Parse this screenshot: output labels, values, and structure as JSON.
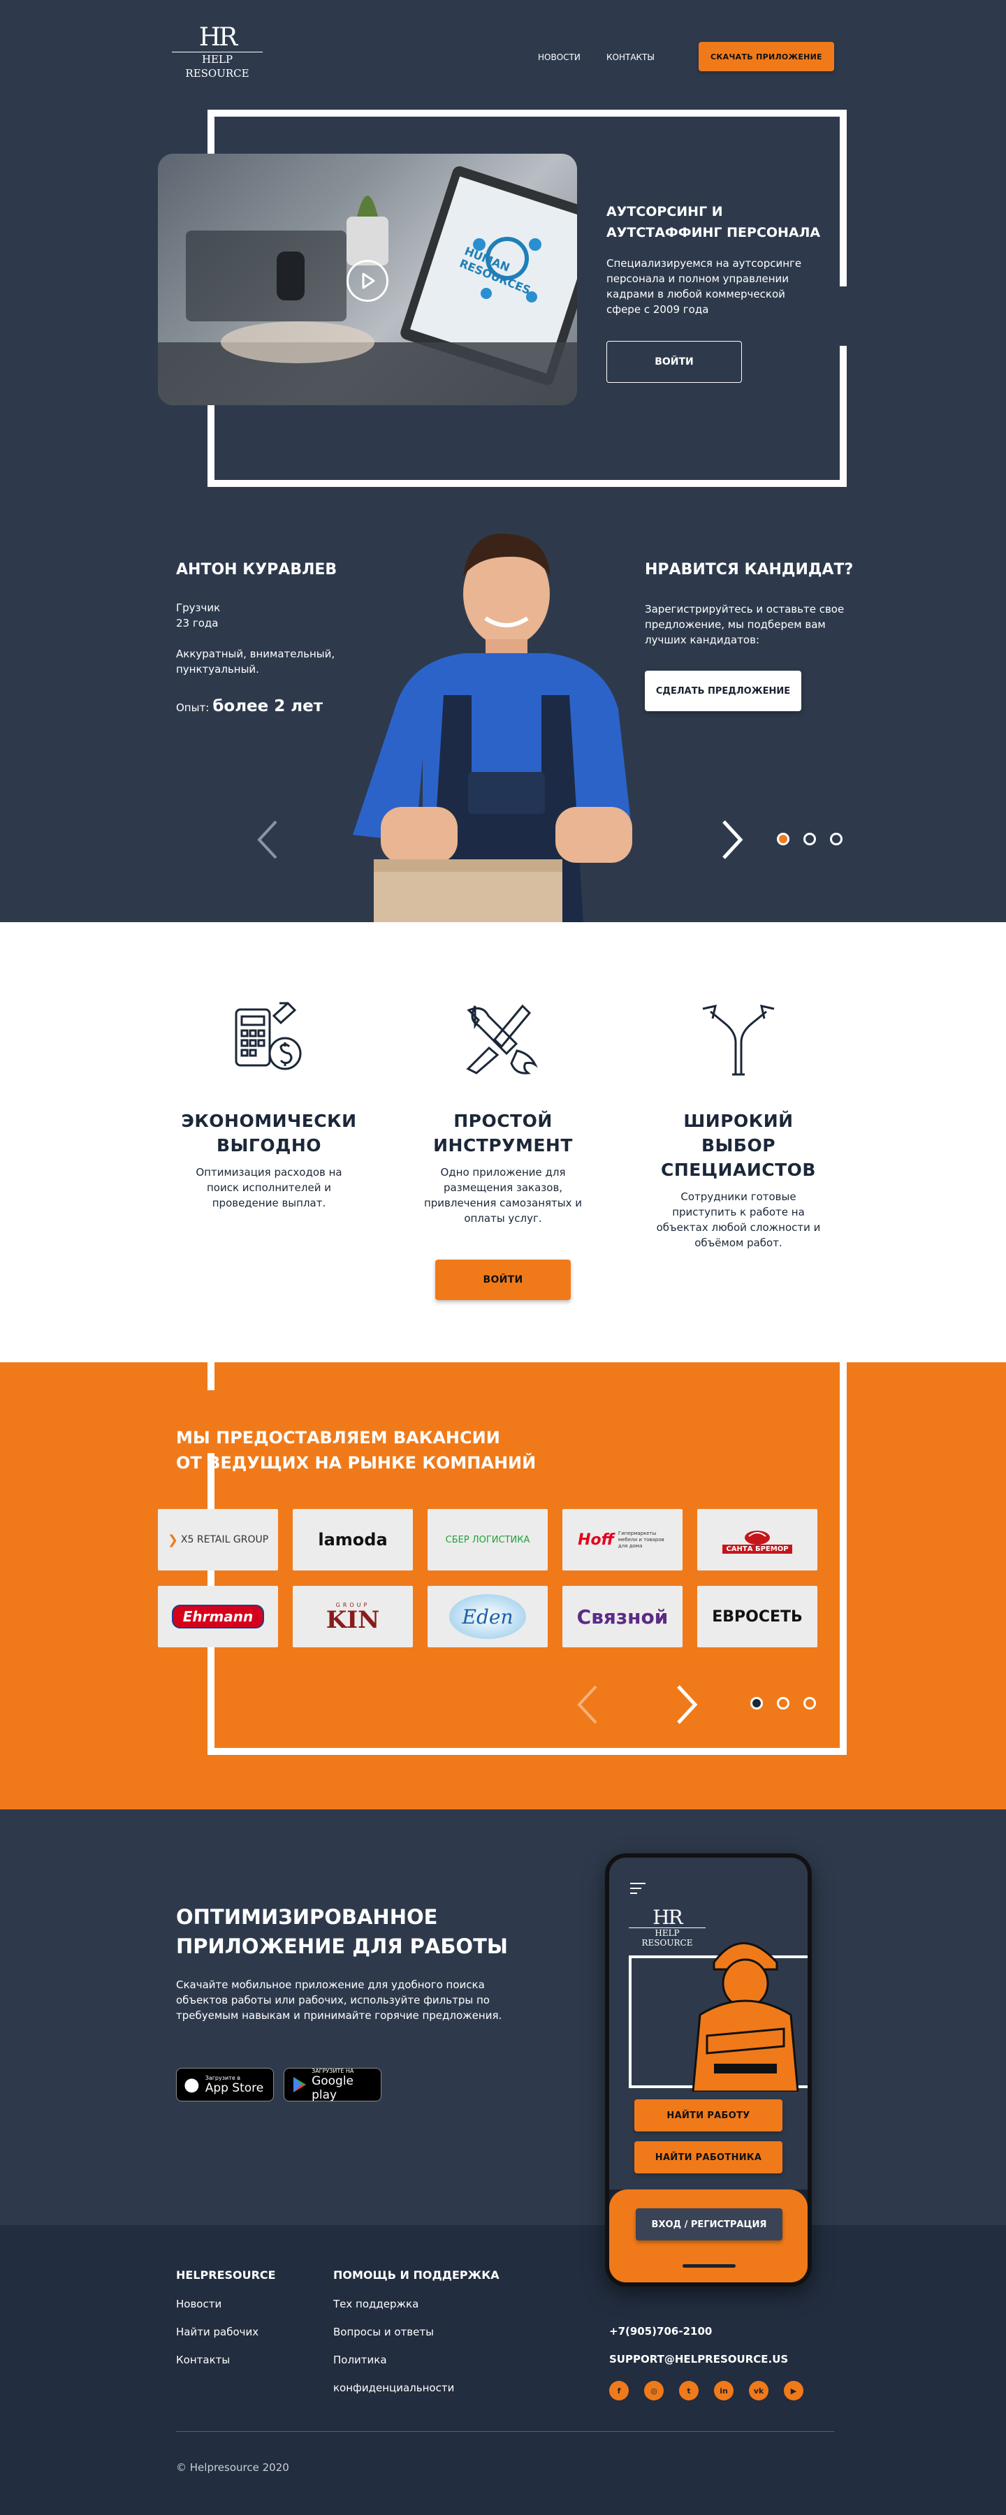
{
  "colors": {
    "bg_dark": "#2e3a4c",
    "accent": "#f07a1a",
    "footer": "#222d3f",
    "white": "#ffffff"
  },
  "header": {
    "logo_mark": "HR",
    "logo_text": "HELP RESOURCE",
    "nav": [
      "НОВОСТИ",
      "КОНТАКТЫ"
    ],
    "cta": "СКАЧАТЬ ПРИЛОЖЕНИЕ"
  },
  "hero": {
    "title_line1": "АУТСОРСИНГ И",
    "title_line2": "АУТСТАФФИНГ ПЕРСОНАЛА",
    "text": "Специализируемся на аутсорсинге персонала и полном управлении кадрами в любой коммерческой сфере с 2009 года",
    "button": "ВОЙТИ",
    "video_caption": "HUMAN RESOURCES",
    "play_icon": "play-icon"
  },
  "candidate": {
    "name": "АНТОН КУРАВЛЕВ",
    "role": "Грузчик",
    "age": "23 года",
    "traits": "Аккуратный, внимательный, пунктуальный.",
    "exp_label": "Опыт:",
    "exp_value": "более 2 лет",
    "offer_title": "НРАВИТСЯ КАНДИДАТ?",
    "offer_text": "Зарегистрируйтесь и оставьте свое предложение, мы подберем вам лучших кандидатов:",
    "offer_button": "СДЕЛАТЬ ПРЕДЛОЖЕНИЕ"
  },
  "features": {
    "items": [
      {
        "title_line1": "ЭКОНОМИЧЕСКИ",
        "title_line2": "ВЫГОДНО",
        "text": "Оптимизация расходов на поиск исполнителей и проведение выплат.",
        "icon": "calculator-money-icon"
      },
      {
        "title_line1": "ПРОСТОЙ",
        "title_line2": "ИНСТРУМЕНТ",
        "text": "Одно приложение для размещения заказов, привлечения самозанятых и оплаты услуг.",
        "icon": "tools-icon"
      },
      {
        "title_line1": "ШИРОКИЙ ВЫБОР",
        "title_line2": "СПЕЦИАИСТОВ",
        "text": "Сотрудники готовые приступить к работе на объектах любой сложности и объёмом работ.",
        "icon": "split-arrows-icon"
      }
    ],
    "button": "ВОЙТИ"
  },
  "partners": {
    "title_line1": "МЫ ПРЕДОСТАВЛЯЕМ ВАКАНСИИ",
    "title_line2": "ОТ ВЕДУЩИХ НА РЫНКЕ КОМПАНИЙ",
    "logos": [
      "X5 RETAIL GROUP",
      "lamoda",
      "СБЕР ЛОГИСТИКА",
      "Hoff",
      "САНТА БРЕМОР",
      "Ehrmann",
      "KIN",
      "Eden",
      "Связной",
      "ЕВРОСЕТЬ"
    ],
    "hoff_sub": "Гипермаркеты мебели и товаров для дома",
    "kin_sub": "GROUP"
  },
  "app": {
    "title_line1": "ОПТИМИЗИРОВАННОЕ",
    "title_line2": "ПРИЛОЖЕНИЕ ДЛЯ РАБОТЫ",
    "text": "Скачайте мобильное приложение для удобного поиска объектов работы или рабочих, используйте фильтры по требуемым навыкам и принимайте горячие предложения.",
    "appstore_small": "Загрузите в",
    "appstore_big": "App Store",
    "gplay_small": "ЗАГРУЗИТЕ НА",
    "gplay_big": "Google play",
    "phone": {
      "logo_mark": "HR",
      "logo_text": "HELP RESOURCE",
      "btn1": "НАЙТИ РАБОТУ",
      "btn2": "НАЙТИ РАБОТНИКА",
      "btn3": "ВХОД / РЕГИСТРАЦИЯ"
    }
  },
  "footer": {
    "col1_title": "HELPRESOURCE",
    "col1_links": [
      "Новости",
      "Найти рабочих",
      "Контакты"
    ],
    "col2_title": "ПОМОЩЬ И ПОДДЕРЖКА",
    "col2_links": [
      "Тех поддержка",
      "Вопросы и ответы",
      "Политика",
      "конфиденциальности"
    ],
    "phone": "+7(905)706-2100",
    "email": "SUPPORT@HELPRESOURCE.US",
    "social": [
      "facebook-icon",
      "instagram-icon",
      "twitter-icon",
      "linkedin-icon",
      "vk-icon",
      "youtube-icon"
    ],
    "copyright": "© Helpresource 2020"
  }
}
